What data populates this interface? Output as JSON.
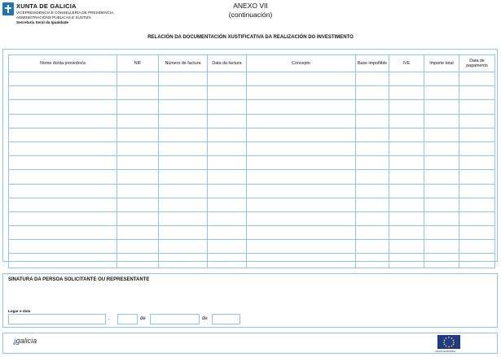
{
  "header": {
    "org_name": "XUNTA DE GALICIA",
    "org_lines": [
      "VICEPRESIDENCIA E CONSELLERÍA DE PRESIDENCIA,",
      "ADMINISTRACIÓNS PÚBLICAS E XUSTIZA",
      "Secretaría Xeral da Igualdade"
    ],
    "annex_title": "ANEXO VII",
    "annex_subtitle": "(continuación)",
    "logo_icon": "xunta-cross-icon"
  },
  "section_title": "RELACIÓN DA DOCUMENTACIÓN XUSTIFICATIVA DA REALIZACIÓN DO INVESTIMENTO",
  "table": {
    "columns": [
      "Nome do/da provedor/a",
      "NIF",
      "Número de factura",
      "Data da factura",
      "Concepto",
      "Base impoñible",
      "IVE",
      "Importe total",
      "Data de pagamento"
    ],
    "rows": [
      [
        "",
        "",
        "",
        "",
        "",
        "",
        "",
        "",
        ""
      ],
      [
        "",
        "",
        "",
        "",
        "",
        "",
        "",
        "",
        ""
      ],
      [
        "",
        "",
        "",
        "",
        "",
        "",
        "",
        "",
        ""
      ],
      [
        "",
        "",
        "",
        "",
        "",
        "",
        "",
        "",
        ""
      ],
      [
        "",
        "",
        "",
        "",
        "",
        "",
        "",
        "",
        ""
      ],
      [
        "",
        "",
        "",
        "",
        "",
        "",
        "",
        "",
        ""
      ],
      [
        "",
        "",
        "",
        "",
        "",
        "",
        "",
        "",
        ""
      ],
      [
        "",
        "",
        "",
        "",
        "",
        "",
        "",
        "",
        ""
      ],
      [
        "",
        "",
        "",
        "",
        "",
        "",
        "",
        "",
        ""
      ],
      [
        "",
        "",
        "",
        "",
        "",
        "",
        "",
        "",
        ""
      ],
      [
        "",
        "",
        "",
        "",
        "",
        "",
        "",
        "",
        ""
      ],
      [
        "",
        "",
        "",
        "",
        "",
        "",
        "",
        "",
        ""
      ],
      [
        "",
        "",
        "",
        "",
        "",
        "",
        "",
        "",
        ""
      ],
      [
        "",
        "",
        "",
        "",
        "",
        "",
        "",
        "",
        ""
      ]
    ]
  },
  "signature": {
    "title": "SINATURA DA PERSOA SOLICITANTE OU REPRESENTANTE",
    "place_date_label": "Lugar e data",
    "separators": [
      ",",
      "de",
      "de"
    ],
    "fields": {
      "place": "",
      "day": "",
      "month": "",
      "year": ""
    }
  },
  "footer": {
    "brand": "galicia",
    "eu_caption": "UNIÓN EUROPEA",
    "colors": {
      "accent": "#8fc6e6",
      "brand_blue": "#1e73b9",
      "eu_blue": "#1e3a8f",
      "eu_star": "#f5d400"
    }
  }
}
